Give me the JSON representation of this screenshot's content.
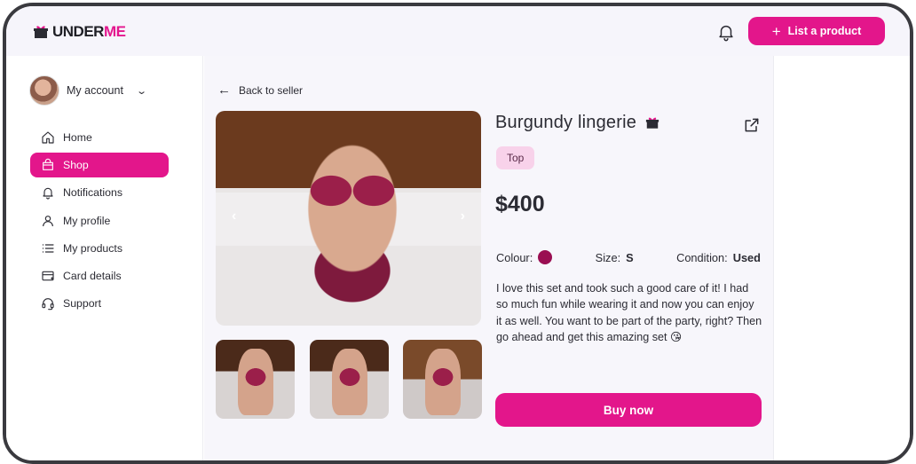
{
  "brand": {
    "name_part1": "UNDER",
    "name_part2": "ME",
    "accent_color": "#e3168b"
  },
  "header": {
    "list_button_label": "List a product",
    "bell_icon": "bell-icon"
  },
  "sidebar": {
    "account_label": "My account",
    "items": [
      {
        "label": "Home",
        "icon": "home-icon",
        "active": false
      },
      {
        "label": "Shop",
        "icon": "shopping-bag-icon",
        "active": true
      },
      {
        "label": "Notifications",
        "icon": "bell-icon",
        "active": false
      },
      {
        "label": "My profile",
        "icon": "user-icon",
        "active": false
      },
      {
        "label": "My products",
        "icon": "list-icon",
        "active": false
      },
      {
        "label": "Card details",
        "icon": "card-icon",
        "active": false
      },
      {
        "label": "Support",
        "icon": "headset-icon",
        "active": false
      }
    ]
  },
  "product": {
    "back_label": "Back to seller",
    "title": "Burgundy lingerie",
    "category": "Top",
    "price": "$400",
    "colour_label": "Colour:",
    "colour_value": "#9a0e52",
    "size_label": "Size:",
    "size_value": "S",
    "condition_label": "Condition:",
    "condition_value": "Used",
    "description": "I love this set and took such a good care of it! I had so much fun while wearing it and now you can enjoy it as well. You want to be part of the party, right? Then go ahead and get this amazing set 😘",
    "buy_label": "Buy now"
  }
}
